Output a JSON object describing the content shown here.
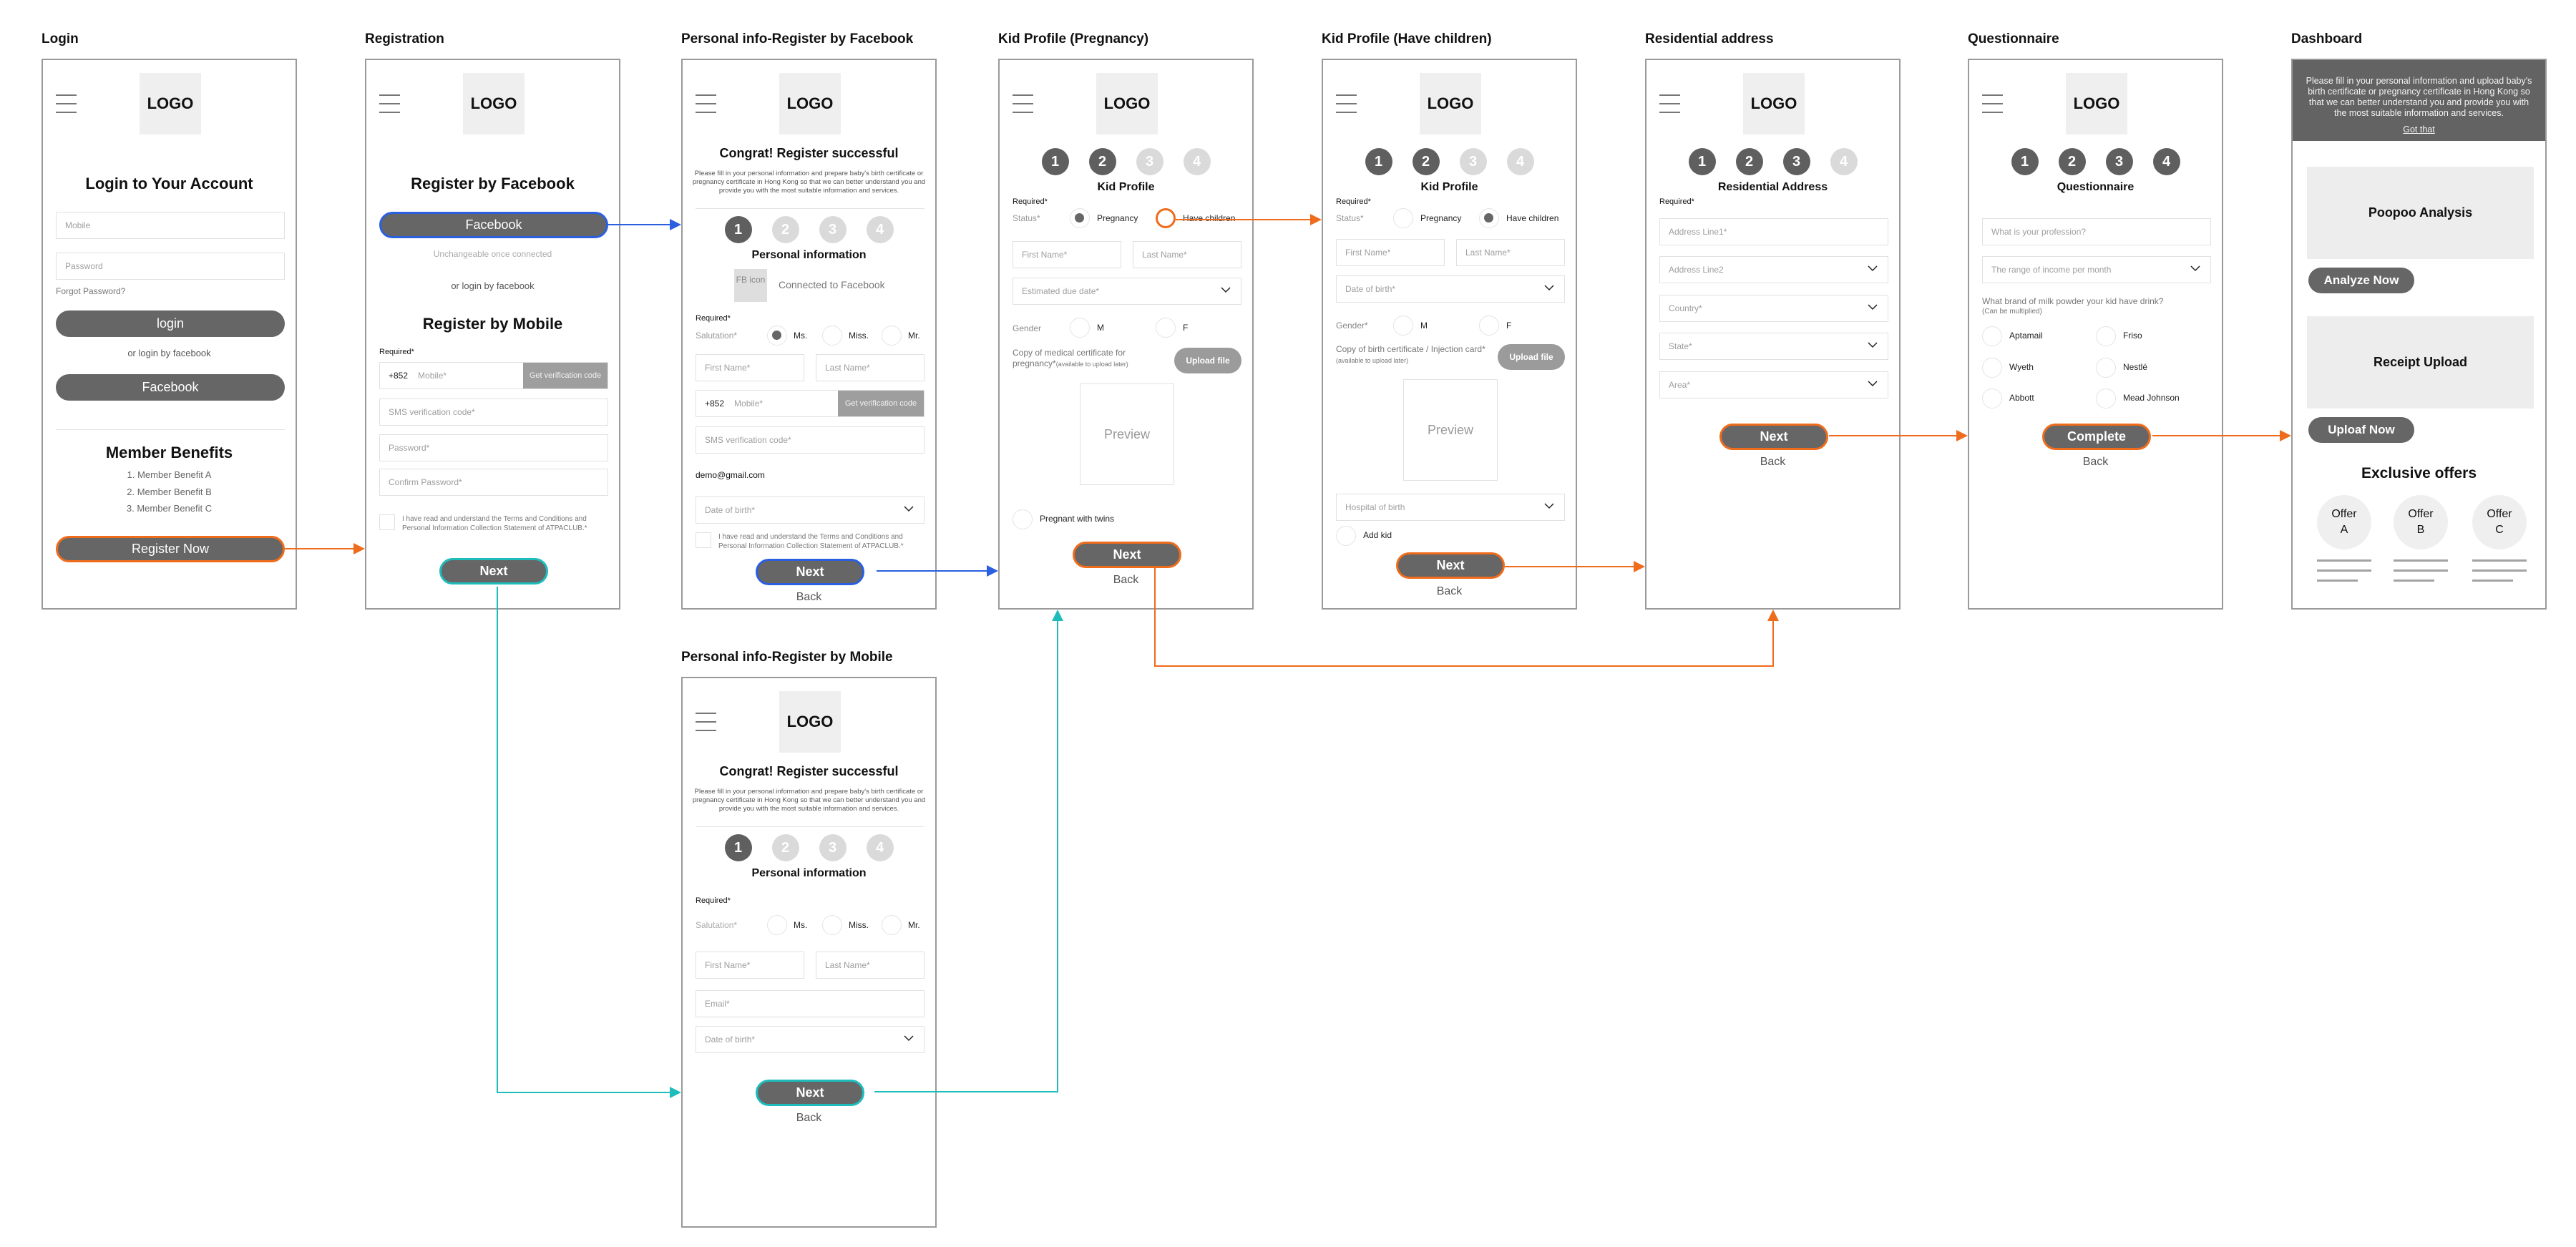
{
  "colors": {
    "flow_orange": "#ef6c1c",
    "flow_blue": "#2a5fe0",
    "flow_teal": "#1fbcbc",
    "button_gray": "#666666",
    "placeholder_gray": "#efefef"
  },
  "common": {
    "logo": "LOGO",
    "required": "Required*",
    "back": "Back",
    "next": "Next",
    "congrat": "Congrat! Register successful",
    "intro_text": "Please fill in your personal information and prepare baby's birth certificate or pregnancy certificate in Hong Kong so that we can better understand you and provide you with the most suitable information and services.",
    "terms": "I have read and understand the Terms and Conditions and Personal Information Collection Statement of ATPACLUB.*",
    "steps": [
      "1",
      "2",
      "3",
      "4"
    ],
    "upload_file": "Upload file",
    "preview": "Preview",
    "mobile_prefix": "+852",
    "mobile_placeholder": "Mobile*",
    "get_code": "Get verification code",
    "sms_placeholder": "SMS verification code*",
    "first_name": "First Name*",
    "last_name": "Last Name*",
    "dob": "Date of birth*"
  },
  "screens": {
    "login": {
      "label": "Login",
      "heading": "Login to Your Account",
      "mobile_placeholder": "Mobile",
      "password_placeholder": "Password",
      "forgot": "Forgot Password?",
      "login_btn": "login",
      "or_fb": "or login by facebook",
      "fb_btn": "Facebook",
      "benefits_title": "Member Benefits",
      "benefits": [
        "1. Member Benefit A",
        "2. Member Benefit B",
        "3. Member Benefit C"
      ],
      "register_btn": "Register Now"
    },
    "registration": {
      "label": "Registration",
      "fb_heading": "Register by Facebook",
      "fb_btn": "Facebook",
      "fb_note": "Unchangeable once connected",
      "or_fb": "or login by facebook",
      "mobile_heading": "Register by Mobile",
      "password": "Password*",
      "confirm_password": "Confirm Password*"
    },
    "personal_fb": {
      "label": "Personal info-Register by Facebook",
      "section": "Personal information",
      "fb_icon": "FB icon",
      "connected": "Connected to Facebook",
      "salutation": "Salutation*",
      "salutation_options": [
        "Ms.",
        "Miss.",
        "Mr."
      ],
      "salutation_selected": "Ms.",
      "email": "demo@gmail.com",
      "current_step": 1
    },
    "personal_mobile": {
      "label": "Personal info-Register by Mobile",
      "section": "Personal information",
      "salutation": "Salutation*",
      "salutation_options": [
        "Ms.",
        "Miss.",
        "Mr."
      ],
      "email_placeholder": "Email*",
      "current_step": 1
    },
    "kid_pregnancy": {
      "label": "Kid Profile (Pregnancy)",
      "section": "Kid Profile",
      "status": "Status*",
      "status_options": [
        "Pregnancy",
        "Have children"
      ],
      "status_selected": "Pregnancy",
      "due_date": "Estimated due date*",
      "gender": "Gender",
      "gender_options": [
        "M",
        "F"
      ],
      "cert_label": "Copy of medical certificate for pregnancy*",
      "cert_note": "(available to upload later)",
      "twins": "Pregnant with twins",
      "current_step": 2
    },
    "kid_children": {
      "label": "Kid Profile (Have children)",
      "section": "Kid Profile",
      "status": "Status*",
      "status_options": [
        "Pregnancy",
        "Have children"
      ],
      "status_selected": "Have children",
      "gender": "Gender*",
      "gender_options": [
        "M",
        "F"
      ],
      "cert_label": "Copy of birth certificate / Injection card*",
      "cert_note": "(available to upload later)",
      "hospital": "Hospital of birth",
      "add_kid": "Add kid",
      "current_step": 2
    },
    "address": {
      "label": "Residential address",
      "section": "Residential Address",
      "fields": [
        "Address Line1*",
        "Address Line2",
        "Country*",
        "State*",
        "Area*"
      ],
      "current_step": 3
    },
    "questionnaire": {
      "label": "Questionnaire",
      "section": "Questionnaire",
      "profession": "What is your profession?",
      "income": "The range of income per month",
      "milk_question": "What brand of milk powder your kid have drink?",
      "milk_note": "(Can be multiplied)",
      "brands": [
        "Aptamail",
        "Friso",
        "Wyeth",
        "Nestlé",
        "Abbott",
        "Mead Johnson"
      ],
      "complete_btn": "Complete",
      "current_step": 4
    },
    "dashboard": {
      "label": "Dashboard",
      "overlay_text": "Please fill in your personal information and upload baby's birth certificate or pregnancy certificate in Hong Kong so that we can better understand you and provide you with the most suitable information and services.",
      "got_that": "Got that",
      "card1": "Poopoo Analysis",
      "card1_btn": "Analyze Now",
      "card2": "Receipt Upload",
      "card2_btn": "Uploaf Now",
      "offers_title": "Exclusive offers",
      "offers": [
        {
          "line1": "Offer",
          "line2": "A"
        },
        {
          "line1": "Offer",
          "line2": "B"
        },
        {
          "line1": "Offer",
          "line2": "C"
        }
      ]
    }
  },
  "flows": [
    {
      "from": "login.register_btn",
      "to": "registration",
      "color": "orange"
    },
    {
      "from": "registration.fb_btn",
      "to": "personal_fb",
      "color": "blue"
    },
    {
      "from": "registration.next",
      "to": "personal_mobile",
      "color": "teal"
    },
    {
      "from": "personal_fb.next",
      "to": "kid_pregnancy",
      "color": "blue"
    },
    {
      "from": "personal_mobile.next",
      "to": "kid_pregnancy",
      "color": "teal"
    },
    {
      "from": "kid_pregnancy.have_children",
      "to": "kid_children",
      "color": "orange"
    },
    {
      "from": "kid_pregnancy.next",
      "to": "address",
      "color": "orange"
    },
    {
      "from": "kid_children.next",
      "to": "address",
      "color": "orange"
    },
    {
      "from": "address.next",
      "to": "questionnaire",
      "color": "orange"
    },
    {
      "from": "questionnaire.complete",
      "to": "dashboard",
      "color": "orange"
    }
  ]
}
